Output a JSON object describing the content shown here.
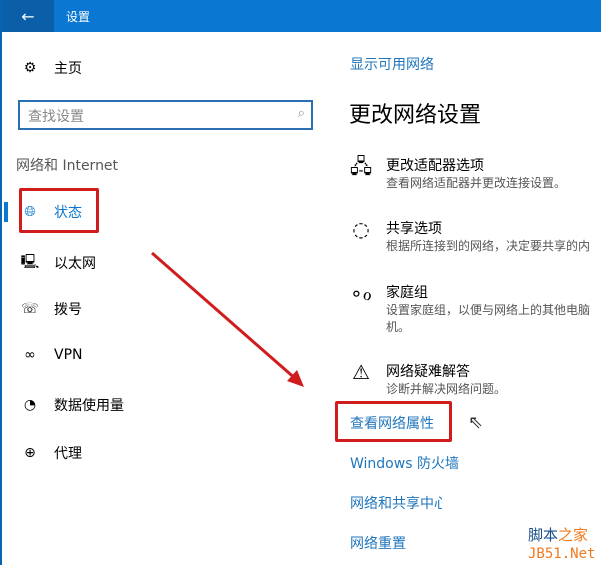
{
  "titlebar": {
    "back_icon": "arrow-left",
    "title": "设置"
  },
  "sidebar": {
    "home": "主页",
    "search_placeholder": "查找设置",
    "section": "网络和 Internet",
    "items": [
      {
        "label": "状态",
        "icon": "globe-icon"
      },
      {
        "label": "以太网",
        "icon": "ethernet-icon"
      },
      {
        "label": "拨号",
        "icon": "dialup-icon"
      },
      {
        "label": "VPN",
        "icon": "vpn-icon"
      },
      {
        "label": "数据使用量",
        "icon": "data-usage-icon"
      },
      {
        "label": "代理",
        "icon": "globe-icon"
      }
    ]
  },
  "main": {
    "show_networks": "显示可用网络",
    "heading": "更改网络设置",
    "options": [
      {
        "title": "更改适配器选项",
        "desc": "查看网络适配器并更改连接设置。"
      },
      {
        "title": "共享选项",
        "desc": "根据所连接到的网络，决定要共享的内"
      },
      {
        "title": "家庭组",
        "desc": "设置家庭组，以便与网络上的其他电脑",
        "desc2": "机。"
      },
      {
        "title": "网络疑难解答",
        "desc": "诊断并解决网络问题。"
      }
    ],
    "links": [
      "查看网络属性",
      "Windows 防火墙",
      "网络和共享中心",
      "网络重置"
    ]
  },
  "watermark": {
    "line1a": "脚本",
    "line1b": "之家",
    "line2": "JB51.Net"
  },
  "colors": {
    "accent": "#0a78d2",
    "link": "#1f76bc",
    "highlight": "#d01c1c"
  }
}
